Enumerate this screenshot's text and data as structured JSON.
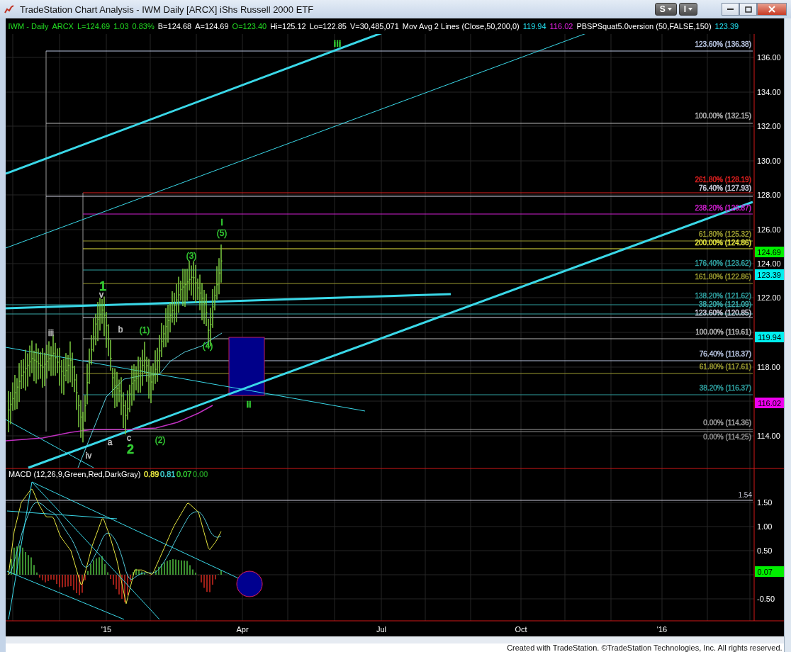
{
  "window": {
    "title": "TradeStation Chart Analysis - IWM Daily [ARCX] iShs Russell 2000 ETF",
    "buttons": [
      {
        "label": "S"
      },
      {
        "label": "I"
      }
    ]
  },
  "info_bar": [
    {
      "text": "IWM - Daily",
      "color": "#22dd22"
    },
    {
      "text": "ARCX",
      "color": "#22dd22"
    },
    {
      "text": "L=124.69",
      "color": "#22dd22"
    },
    {
      "text": "1.03",
      "color": "#22dd22"
    },
    {
      "text": "0.83%",
      "color": "#22dd22"
    },
    {
      "text": "B=124.68",
      "color": "#ffffff"
    },
    {
      "text": "A=124.69",
      "color": "#ffffff"
    },
    {
      "text": "O=123.40",
      "color": "#22dd22"
    },
    {
      "text": "Hi=125.12",
      "color": "#ffffff"
    },
    {
      "text": "Lo=122.85",
      "color": "#ffffff"
    },
    {
      "text": "V=30,485,071",
      "color": "#ffffff"
    },
    {
      "text": "Mov Avg 2 Lines (Close,50,200,0)",
      "color": "#ffffff"
    },
    {
      "text": "119.94",
      "color": "#22e0f0"
    },
    {
      "text": "116.02",
      "color": "#e020e0"
    },
    {
      "text": "PBSPSquat5.0version (50,FALSE,150)",
      "color": "#ffffff"
    },
    {
      "text": "123.39",
      "color": "#22e0f0"
    }
  ],
  "price_pane": {
    "fib_levels": [
      {
        "label": "123.60% (136.38)",
        "color": "#b8c4e0"
      },
      {
        "label": "100.00% (132.15)",
        "color": "#b8b8b8"
      },
      {
        "label": "261.80% (128.19)",
        "color": "#e02020"
      },
      {
        "label": "76.40% (127.93)",
        "color": "#d0d0e0"
      },
      {
        "label": "238.20% (126.87)",
        "color": "#d020d0"
      },
      {
        "label": "61.80% (125.32)",
        "color": "#9a9a30"
      },
      {
        "label": "200.00% (124.86)",
        "color": "#e8e840"
      },
      {
        "label": "176.40% (123.62)",
        "color": "#2fa0a0"
      },
      {
        "label": "161.80% (122.86)",
        "color": "#9a9a30"
      },
      {
        "label": "138.20% (121.62)",
        "color": "#2fa0a0"
      },
      {
        "label": "38.20% (121.09)",
        "color": "#3aa8a8"
      },
      {
        "label": "123.60% (120.85)",
        "color": "#d0d0e0"
      },
      {
        "label": "100.00% (119.61)",
        "color": "#b8b8b8"
      },
      {
        "label": "76.40% (118.37)",
        "color": "#b8c4e0"
      },
      {
        "label": "61.80% (117.61)",
        "color": "#9a9a30"
      },
      {
        "label": "38.20% (116.37)",
        "color": "#2fa0a0"
      },
      {
        "label": "0.00% (114.36)",
        "color": "#a0a0a0"
      },
      {
        "label": "0.00% (114.25)",
        "color": "#909090"
      }
    ],
    "wave_labels": [
      {
        "text": "iii",
        "color": "#33cc33",
        "kind": "bold"
      },
      {
        "text": "i",
        "color": "#33cc33",
        "kind": "bold"
      },
      {
        "text": "(5)",
        "color": "#33cc33",
        "kind": "plain"
      },
      {
        "text": "(3)",
        "color": "#33cc33",
        "kind": "plain"
      },
      {
        "text": "1",
        "color": "#33cc33",
        "kind": "large"
      },
      {
        "text": "v",
        "color": "#c8c8c8",
        "kind": "plain"
      },
      {
        "text": "iii",
        "color": "#c8c8c8",
        "kind": "plain"
      },
      {
        "text": "b",
        "color": "#c8c8c8",
        "kind": "plain"
      },
      {
        "text": "(1)",
        "color": "#33cc33",
        "kind": "plain"
      },
      {
        "text": "(4)",
        "color": "#33cc33",
        "kind": "plain"
      },
      {
        "text": "ii",
        "color": "#33cc33",
        "kind": "bold"
      },
      {
        "text": "a",
        "color": "#c8c8c8",
        "kind": "plain"
      },
      {
        "text": "c",
        "color": "#c8c8c8",
        "kind": "plain"
      },
      {
        "text": "2",
        "color": "#33cc33",
        "kind": "large"
      },
      {
        "text": "(2)",
        "color": "#33cc33",
        "kind": "plain"
      },
      {
        "text": "iv",
        "color": "#c8c8c8",
        "kind": "plain"
      }
    ],
    "axis_labels": [
      "136.00",
      "134.00",
      "132.00",
      "130.00",
      "128.00",
      "126.00",
      "124.00",
      "122.00",
      "118.00",
      "114.00"
    ],
    "price_badges": [
      {
        "text": "124.69",
        "color": "#00ee00"
      },
      {
        "text": "123.39",
        "color": "#00eeee"
      },
      {
        "text": "119.94",
        "color": "#00eeee"
      },
      {
        "text": "116.02",
        "color": "#ee00ee"
      }
    ],
    "date_labels": [
      "'15",
      "Apr",
      "Jul",
      "Oct",
      "'16"
    ]
  },
  "macd_pane": {
    "title": "MACD (12,26,9,Green,Red,DarkGray)",
    "values": [
      {
        "text": "0.89",
        "color": "#e8e840"
      },
      {
        "text": "0.81",
        "color": "#40d0d0"
      },
      {
        "text": "0.07",
        "color": "#33cc33"
      },
      {
        "text": "0.00",
        "color": "#208a20"
      }
    ],
    "level_label": "1.54",
    "axis_labels": [
      "1.50",
      "1.00",
      "0.50",
      "-0.50"
    ],
    "badge": {
      "text": "0.07",
      "color": "#00ee00"
    }
  },
  "footer": "Created with TradeStation. ©TradeStation Technologies, Inc. All rights reserved."
}
